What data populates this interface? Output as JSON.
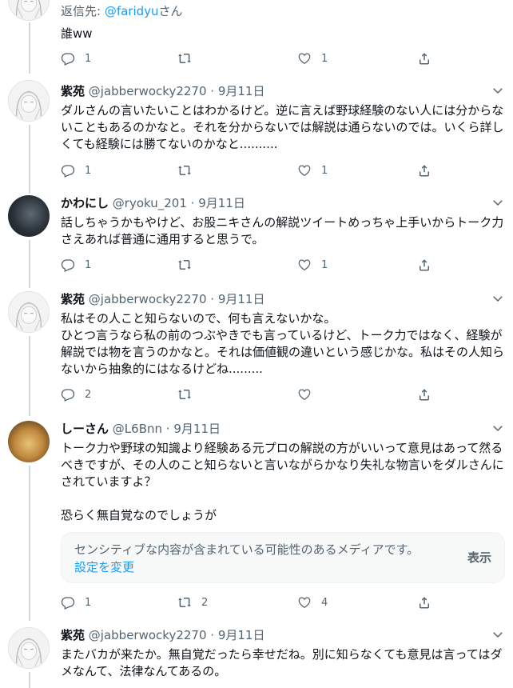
{
  "tweets": [
    {
      "reply_prefix": "返信先: ",
      "reply_mention": "@faridyu",
      "reply_suffix": "さん",
      "text": "誰ww",
      "replies": "1",
      "retweets": "",
      "likes": "1"
    },
    {
      "name": "紫苑",
      "handle": "@jabberwocky2270",
      "separator": "·",
      "date": "9月11日",
      "text": "ダルさんの言いたいことはわかるけど。逆に言えば野球経験のない人には分からないこともあるのかなと。それを分からないでは解説は通らないのでは。いくら詳しくても経験には勝てないのかなと..........",
      "replies": "1",
      "retweets": "",
      "likes": "1"
    },
    {
      "name": "かわにし",
      "handle": "@ryoku_201",
      "separator": "·",
      "date": "9月11日",
      "text": "話しちゃうかもやけど、お股ニキさんの解説ツイートめっちゃ上手いからトーク力さえあれば普通に通用すると思うで。",
      "replies": "1",
      "retweets": "",
      "likes": "1"
    },
    {
      "name": "紫苑",
      "handle": "@jabberwocky2270",
      "separator": "·",
      "date": "9月11日",
      "text": "私はその人こと知らないので、何も言えないかな。\nひとつ言うなら私の前のつぶやきでも言っているけど、トーク力ではなく、経験が解説では物を言うのかなと。それは価値観の違いという感じかな。私はその人知らないから抽象的にはなるけどね.........",
      "replies": "2",
      "retweets": "",
      "likes": ""
    },
    {
      "name": "しーさん",
      "handle": "@L6Bnn",
      "separator": "·",
      "date": "9月11日",
      "text": "トーク力や野球の知識より経験ある元プロの解説の方がいいって意見はあって然るべきですが、その人のこと知らないと言いながらかなり失礼な物言いをダルさんにされていますよ？\n\n恐らく無自覚なのでしょうが",
      "sensitive_notice": "センシティブな内容が含まれている可能性のあるメディアです。",
      "sensitive_link": "設定を変更",
      "show_label": "表示",
      "replies": "1",
      "retweets": "2",
      "likes": "4"
    },
    {
      "name": "紫苑",
      "handle": "@jabberwocky2270",
      "separator": "·",
      "date": "9月11日",
      "text": "またバカが来たか。無自覚だったら幸せだね。別に知らなくても意見は言ってはダメなんて、法律なんてあるの。"
    }
  ],
  "icons": {
    "reply": "reply-icon",
    "retweet": "retweet-icon",
    "like": "like-icon",
    "share": "share-icon",
    "more": "chevron-down-icon"
  },
  "colors": {
    "accent": "#1d9bf0",
    "secondary_text": "#536471",
    "thread_line": "#cfd9de"
  }
}
